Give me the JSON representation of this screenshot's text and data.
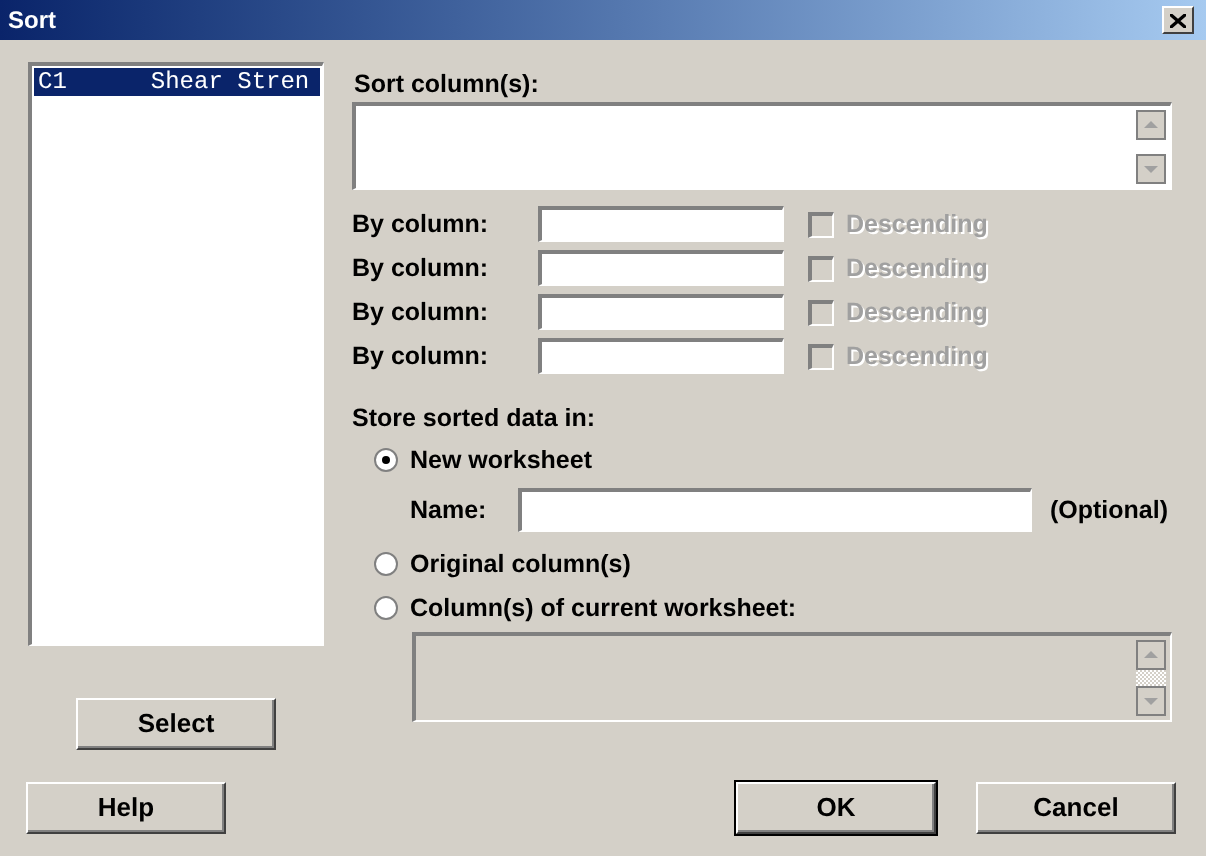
{
  "window": {
    "title": "Sort"
  },
  "column_list": {
    "items": [
      {
        "id_label": "C1",
        "name": "Shear Stren",
        "selected": true
      }
    ],
    "select_button": "Select"
  },
  "sort_columns": {
    "label": "Sort column(s):"
  },
  "by_columns": [
    {
      "label": "By column:",
      "descending_label": "Descending",
      "checked": false,
      "disabled": true
    },
    {
      "label": "By column:",
      "descending_label": "Descending",
      "checked": false,
      "disabled": true
    },
    {
      "label": "By column:",
      "descending_label": "Descending",
      "checked": false,
      "disabled": true
    },
    {
      "label": "By column:",
      "descending_label": "Descending",
      "checked": false,
      "disabled": true
    }
  ],
  "store": {
    "label": "Store sorted data in:",
    "options": [
      {
        "kind": "name",
        "label": "New worksheet",
        "selected": true,
        "name_label": "Name:",
        "optional_label": "(Optional)"
      },
      {
        "kind": "plain",
        "label": "Original column(s)",
        "selected": false
      },
      {
        "kind": "columns",
        "label": "Column(s) of current worksheet:",
        "selected": false
      }
    ]
  },
  "buttons": {
    "help": "Help",
    "ok": "OK",
    "cancel": "Cancel"
  }
}
